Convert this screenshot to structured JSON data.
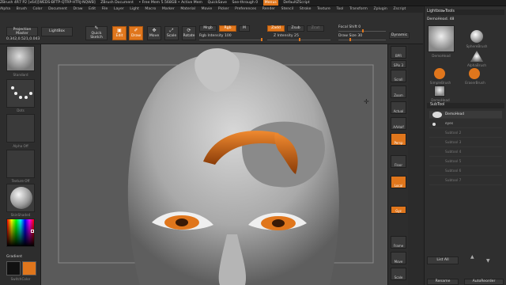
{
  "titlebar": {
    "items": [
      "ZBrush 4R7 P2 [x64][WEDS-BFTP-QTRP-HTRJ-NQWB]",
      "ZBrush Document",
      "• Free Mem 5.568GB • Active Mem",
      "QuickSave",
      "See-through 0",
      "Menus",
      "DefaultZScript"
    ]
  },
  "menus": [
    "Alpha",
    "Brush",
    "Color",
    "Document",
    "Draw",
    "Edit",
    "File",
    "Layer",
    "Light",
    "Macro",
    "Marker",
    "Material",
    "Movie",
    "Picker",
    "Preferences",
    "Render",
    "Stencil",
    "Stroke",
    "Texture",
    "Tool",
    "Transform",
    "Zplugin",
    "Zscript"
  ],
  "shelf": {
    "projection_master": "Projection Master",
    "lightbox": "LightBox",
    "quick_sketch": "Quick Sketch",
    "edit": "Edit",
    "draw": "Draw",
    "move": "Move",
    "scale": "Scale",
    "rotate": "Rotate",
    "mrgb": "Mrgb",
    "rgb": "Rgb",
    "m": "M",
    "zadd": "Zadd",
    "zsub": "Zsub",
    "zcut": "Zcut",
    "rgb_intensity": "Rgb Intensity 100",
    "z_intensity": "Z Intensity 25",
    "focal_shift": "Focal Shift 0",
    "draw_size": "Draw Size 30",
    "dynamic": "Dynamic",
    "coords": "0.342,0.521,0.043"
  },
  "left": {
    "brush": "Standard",
    "stroke": "Dots",
    "alpha": "Alpha Off",
    "texture": "Texture Off",
    "material": "SkinShade4",
    "gradient": "Gradient",
    "switch_color": "SwitchColor"
  },
  "right_tools": [
    "BPR",
    "SPix 3",
    "Scroll",
    "Zoom",
    "Actual",
    "AAHalf",
    "Persp",
    "Floor",
    "Local",
    "Gyz",
    "Frame",
    "Move",
    "Scale"
  ],
  "lightbox_tools": {
    "title": "Lightbox▸Tools",
    "current": "DemoHead. 48",
    "items": [
      "DemoHead",
      "SphereBrush",
      "AlphaBrush",
      "SimpleBrush",
      "EraserBrush",
      "DemoHead"
    ]
  },
  "subtool": {
    "title": "SubTool",
    "items": [
      "DemoHead",
      "eyes",
      "Subtool 2",
      "Subtool 3",
      "Subtool 4",
      "Subtool 5",
      "Subtool 6",
      "Subtool 7"
    ],
    "list_all": "List All",
    "rename": "Rename",
    "autoreorder": "AutoReorder"
  },
  "colors": {
    "accent": "#e0761c",
    "ui_bg": "#2f2f2f",
    "canvas_bg": "#5a5a5a",
    "front_color": "#e0761c"
  }
}
